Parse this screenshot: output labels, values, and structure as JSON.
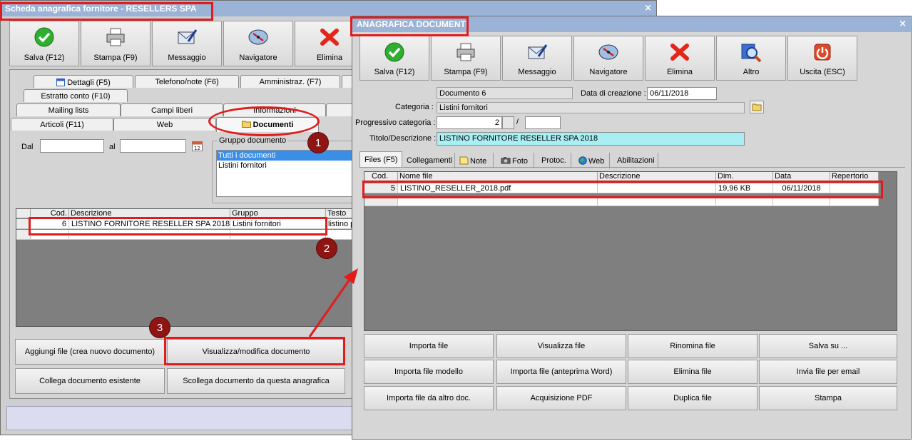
{
  "left_window": {
    "title": "Scheda anagrafica fornitore - RESELLERS SPA",
    "close": "×",
    "toolbar": [
      "Salva (F12)",
      "Stampa (F9)",
      "Messaggio",
      "Navigatore",
      "Elimina"
    ],
    "tabs_row1": [
      "Dettagli (F5)",
      "Telefono/note (F6)",
      "Amministraz. (F7)"
    ],
    "tabs_row2": [
      "Estratto conto (F10)"
    ],
    "tabs_row3": [
      "Mailing lists",
      "Campi liberi",
      "Informazioni"
    ],
    "tabs_row4": [
      "Articoli (F11)",
      "Web",
      "Documenti"
    ],
    "filter": {
      "dal_label": "Dal",
      "al_label": "al",
      "dal_value": "",
      "al_value": ""
    },
    "gruppo": {
      "label": "Gruppo documento",
      "items": [
        "Tutti i documenti",
        "Listini fornitori"
      ]
    },
    "grid": {
      "headers": [
        "Cod.",
        "Descrizione",
        "Gruppo",
        "Testo"
      ],
      "rows": [
        {
          "cod": "6",
          "descrizione": "LISTINO FORNITORE RESELLER SPA 2018",
          "gruppo": "Listini fornitori",
          "testo": "listino p"
        }
      ]
    },
    "buttons": [
      "Aggiungi file (crea nuovo documento)",
      "Visualizza/modifica documento",
      "Collega documento esistente",
      "Scollega documento da questa anagrafica"
    ]
  },
  "right_window": {
    "title": "ANAGRAFICA DOCUMENTI",
    "close": "×",
    "toolbar": [
      "Salva (F12)",
      "Stampa (F9)",
      "Messaggio",
      "Navigatore",
      "Elimina",
      "Altro",
      "Uscita (ESC)"
    ],
    "documento": "Documento 6",
    "data_creazione_label": "Data di creazione :",
    "data_creazione": "06/11/2018",
    "categoria_label": "Categoria :",
    "categoria": "Listini fornitori",
    "progressivo_label": "Progressivo categoria :",
    "progressivo": "2",
    "progressivo_sep": "/",
    "progressivo_tot": "",
    "titolo_label": "Titolo/Descrizione :",
    "titolo": "LISTINO FORNITORE RESELLER SPA 2018",
    "tabs": [
      "Files (F5)",
      "Collegamenti",
      "Note",
      "Foto",
      "Protoc.",
      "Web",
      "Abilitazioni"
    ],
    "grid": {
      "headers": [
        "Cod.",
        "Nome file",
        "Descrizione",
        "Dim.",
        "Data",
        "Repertorio"
      ],
      "rows": [
        {
          "cod": "5",
          "nome": "LISTINO_RESELLER_2018.pdf",
          "descrizione": "",
          "dim": "19,96 KB",
          "data": "06/11/2018",
          "repertorio": ""
        }
      ]
    },
    "buttons": [
      "Importa file",
      "Visualizza file",
      "Rinomina file",
      "Salva su ...",
      "Importa file modello",
      "Importa file (anteprima Word)",
      "Elimina file",
      "Invia file per email",
      "Importa file da altro doc.",
      "Acquisizione PDF",
      "Duplica file",
      "Stampa"
    ]
  },
  "badges": [
    "1",
    "2",
    "3"
  ],
  "colors": {
    "titlebar": "#9ab3d6",
    "highlight": "#e01c1c",
    "badge": "#8f1414",
    "titolo_bg": "#a8eef2",
    "selection": "#3a8ee6"
  }
}
